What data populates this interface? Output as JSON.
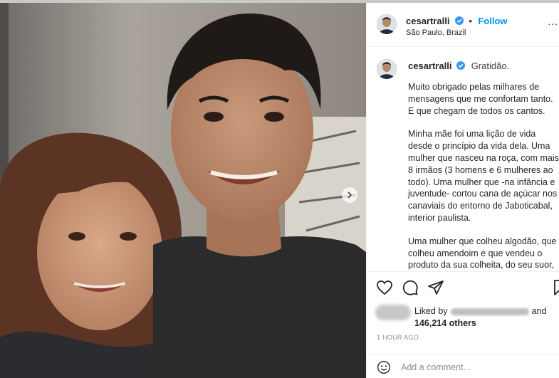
{
  "post": {
    "username": "cesartralli",
    "separator": "•",
    "follow_label": "Follow",
    "location": "São Paulo, Brazil",
    "more_label": "...",
    "photo_alt": "Cesar Tralli and his mother smiling",
    "carousel": {
      "slides": 3,
      "active": 0
    }
  },
  "caption": {
    "first_line": "Gratidão.",
    "paragraphs": [
      "Muito obrigado pelas milhares de mensagens que me confortam tanto. E que chegam de todos os cantos.",
      "Minha mãe foi uma lição de vida desde o princípio da vida dela. Uma mulher que nasceu na roça, com mais 8 irmãos (3 homens e 6 mulheres ao todo). Uma mulher que -na infância e juventude- cortou cana de açúcar nos canaviais do entorno de Jaboticabal, interior paulista.",
      "Uma mulher que colheu algodão, que colheu amendoim e que vendeu o produto da sua colheita, do seu suor,"
    ]
  },
  "likes": {
    "prefix": "Liked by",
    "suffix": "and",
    "others": "146,214 others"
  },
  "timestamp": "1 HOUR AGO",
  "comment": {
    "placeholder": "Add a comment..."
  },
  "icons": {
    "like": "heart-icon",
    "comment": "comment-icon",
    "share": "paper-plane-icon",
    "save": "bookmark-icon",
    "emoji": "smiley-icon",
    "verified": "verified-badge-icon",
    "next": "chevron-right-icon"
  },
  "colors": {
    "link": "#0095f6",
    "verified": "#3897f0",
    "text": "#262626",
    "muted": "#8e8e8e"
  }
}
